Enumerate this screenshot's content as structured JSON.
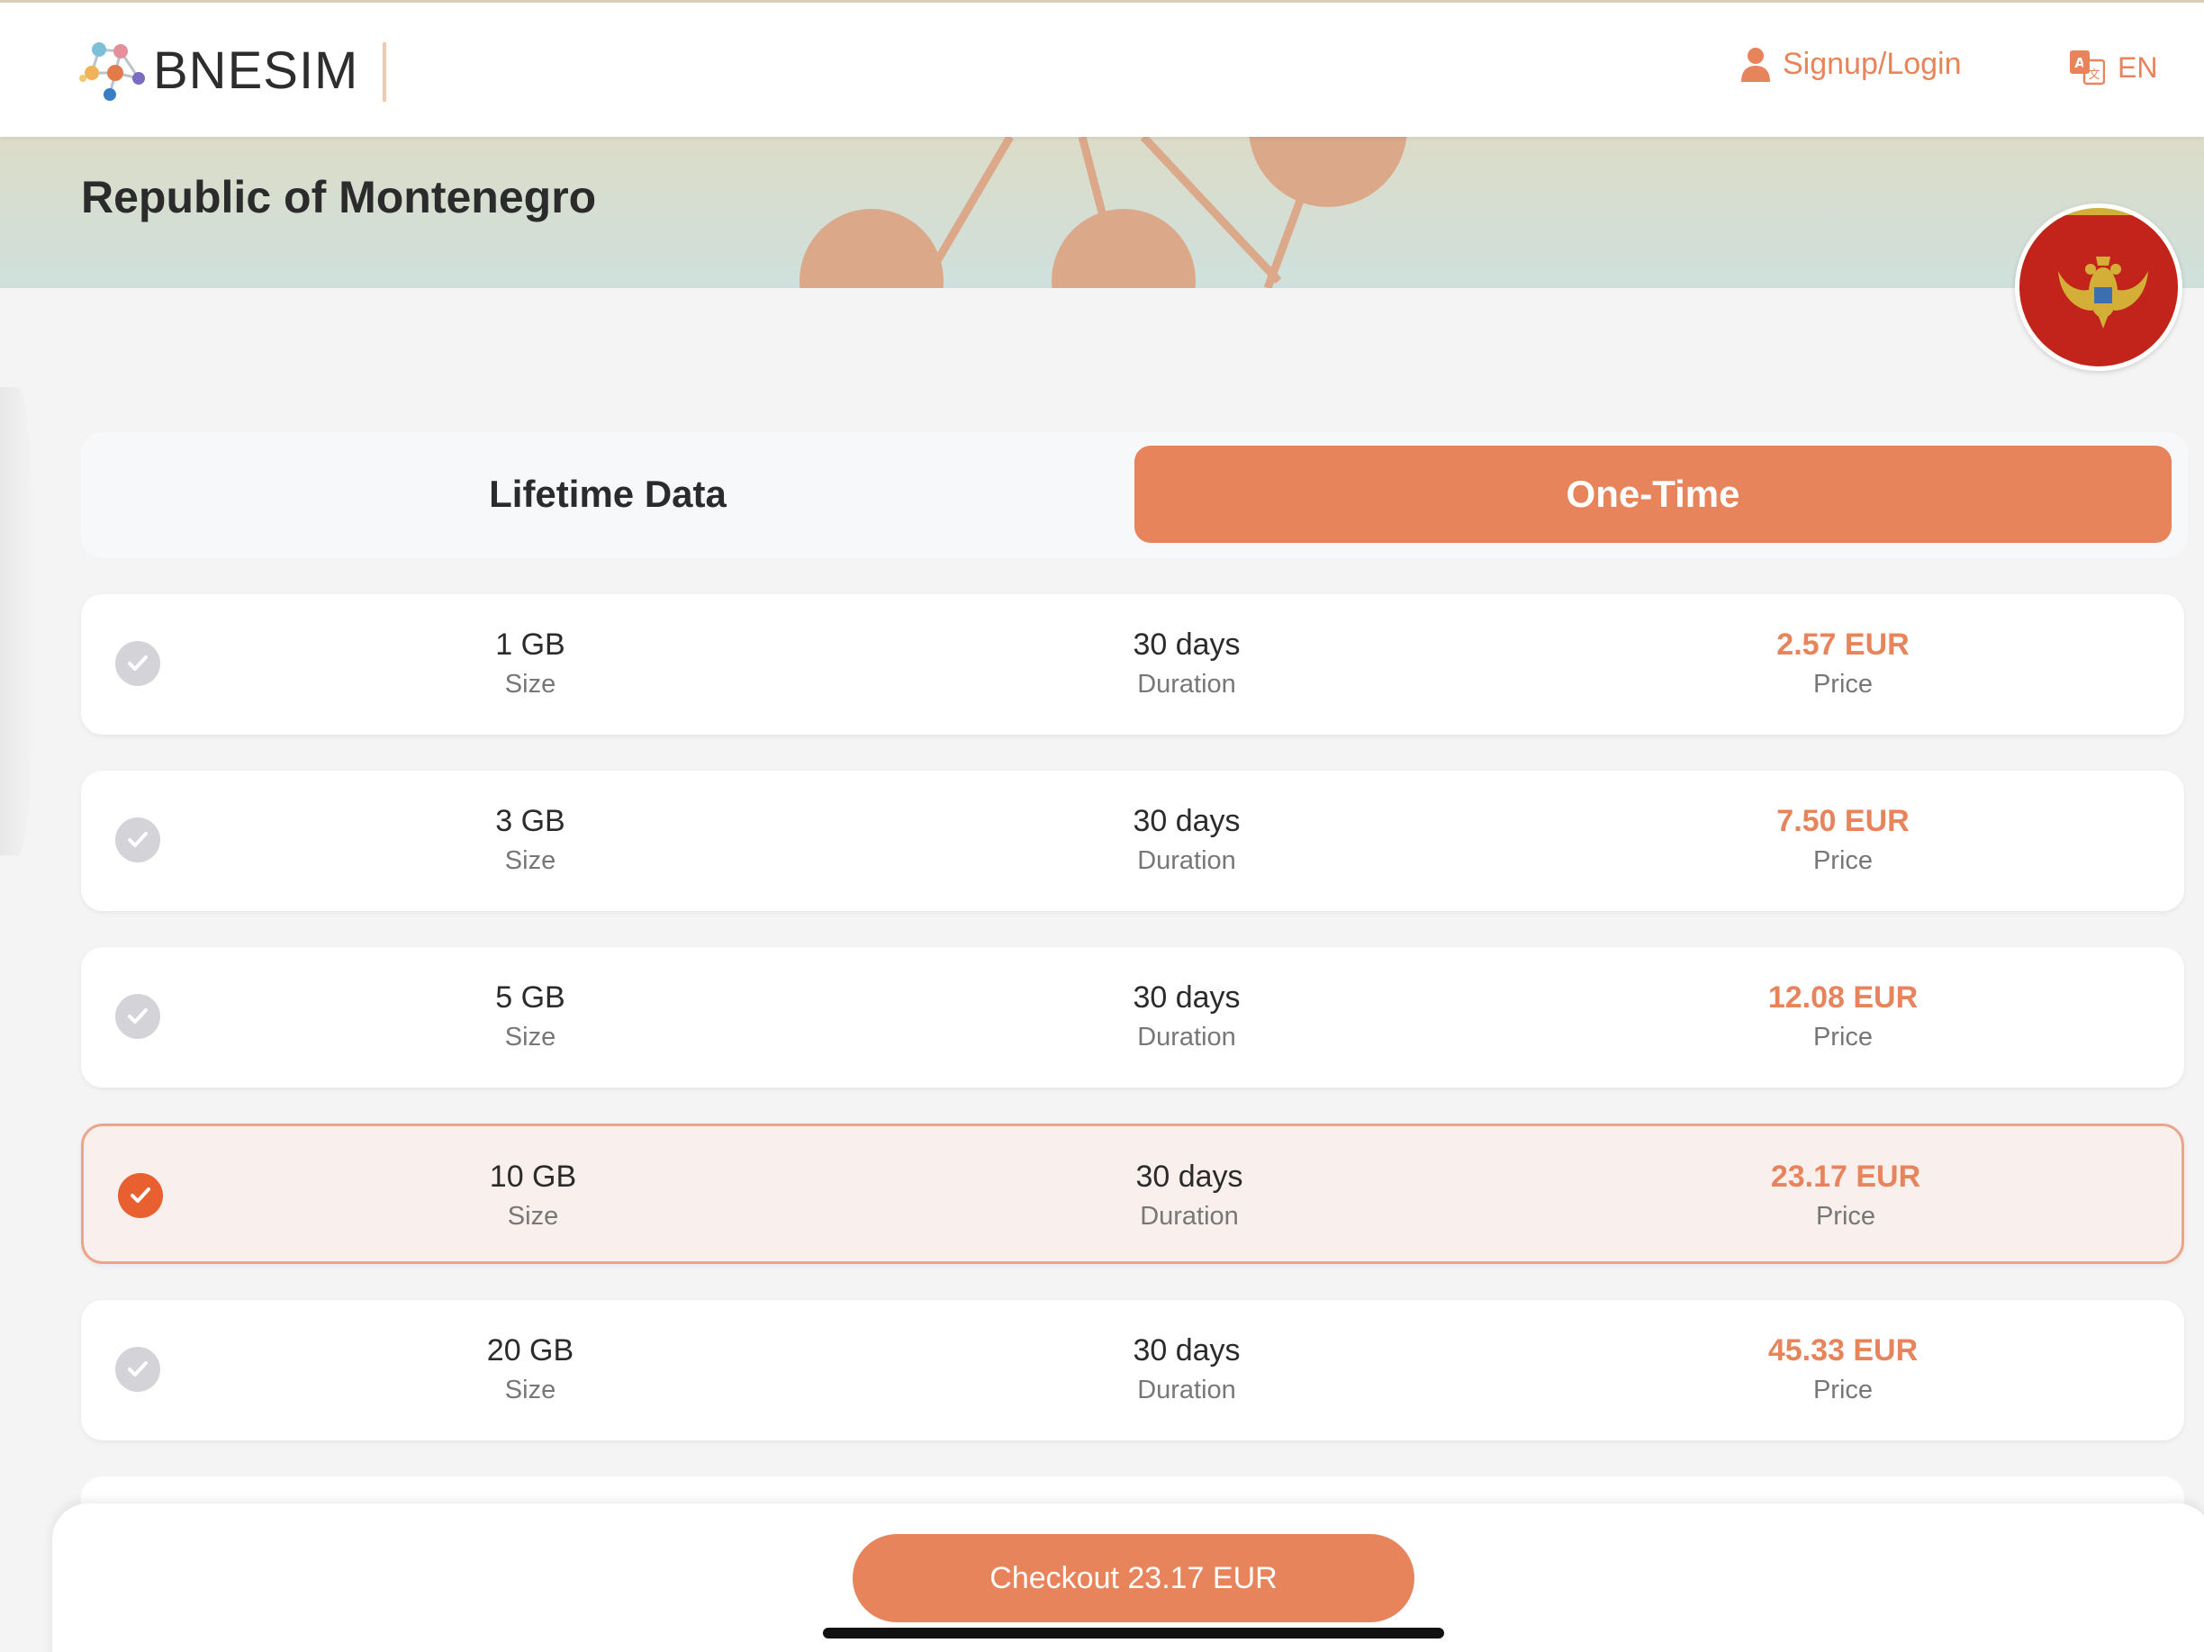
{
  "header": {
    "brand": "BNESIM",
    "signup_label": "Signup/Login",
    "language": "EN"
  },
  "country": {
    "name": "Republic of Montenegro"
  },
  "tabs": [
    {
      "label": "Lifetime Data",
      "active": false
    },
    {
      "label": "One-Time",
      "active": true
    }
  ],
  "plans": [
    {
      "size": "1 GB",
      "size_label": "Size",
      "duration": "30 days",
      "duration_label": "Duration",
      "price": "2.57 EUR",
      "price_label": "Price",
      "selected": false
    },
    {
      "size": "3 GB",
      "size_label": "Size",
      "duration": "30 days",
      "duration_label": "Duration",
      "price": "7.50 EUR",
      "price_label": "Price",
      "selected": false
    },
    {
      "size": "5 GB",
      "size_label": "Size",
      "duration": "30 days",
      "duration_label": "Duration",
      "price": "12.08 EUR",
      "price_label": "Price",
      "selected": false
    },
    {
      "size": "10 GB",
      "size_label": "Size",
      "duration": "30 days",
      "duration_label": "Duration",
      "price": "23.17 EUR",
      "price_label": "Price",
      "selected": true
    },
    {
      "size": "20 GB",
      "size_label": "Size",
      "duration": "30 days",
      "duration_label": "Duration",
      "price": "45.33 EUR",
      "price_label": "Price",
      "selected": false
    }
  ],
  "checkout": {
    "label": "Checkout 23.17 EUR"
  },
  "colors": {
    "accent": "#e8845b",
    "selected_check": "#e8602f",
    "unselected_check": "#d3d3d8",
    "selected_row_bg": "#f9efec"
  },
  "icons": {
    "user": "user-icon",
    "language": "translate-icon",
    "check": "check-icon",
    "flag": "montenegro-flag-icon"
  }
}
